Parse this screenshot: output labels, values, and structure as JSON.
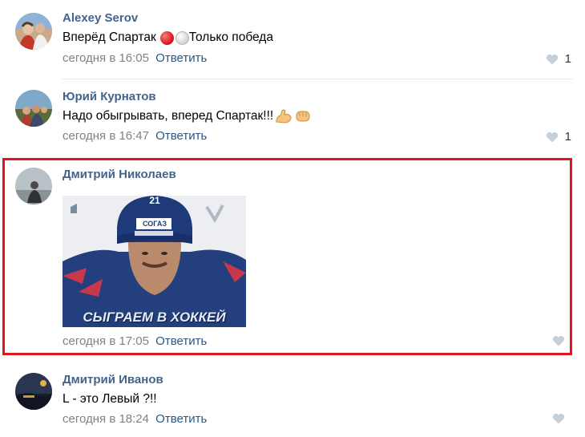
{
  "colors": {
    "author": "#42648b",
    "link": "#2a5885",
    "meta": "#828282",
    "highlight": "#e0151f",
    "divider": "#e7e8ec"
  },
  "comments": [
    {
      "author": "Alexey Serov",
      "text_before": "Вперёд Спартак",
      "text_after": "Только победа",
      "emojis": [
        "red-circle-icon",
        "white-circle-icon"
      ],
      "time": "сегодня в 16:05",
      "reply": "Ответить",
      "likes": "1"
    },
    {
      "author": "Юрий Курнатов",
      "text": "Надо обыгрывать, вперед Спартак!!!",
      "emojis": [
        "flexed-biceps-icon",
        "fist-icon"
      ],
      "time": "сегодня в 16:47",
      "reply": "Ответить",
      "likes": "1"
    },
    {
      "author": "Дмитрий Николаев",
      "image_caption": "СЫГРАЕМ В ХОККЕЙ",
      "image_jersey_text": "СОГАЗ",
      "image_number": "21",
      "time": "сегодня в 17:05",
      "reply": "Ответить",
      "likes": ""
    },
    {
      "author": "Дмитрий Иванов",
      "text": "L - это Левый ?!!",
      "time": "сегодня в 18:24",
      "reply": "Ответить",
      "likes": ""
    }
  ]
}
